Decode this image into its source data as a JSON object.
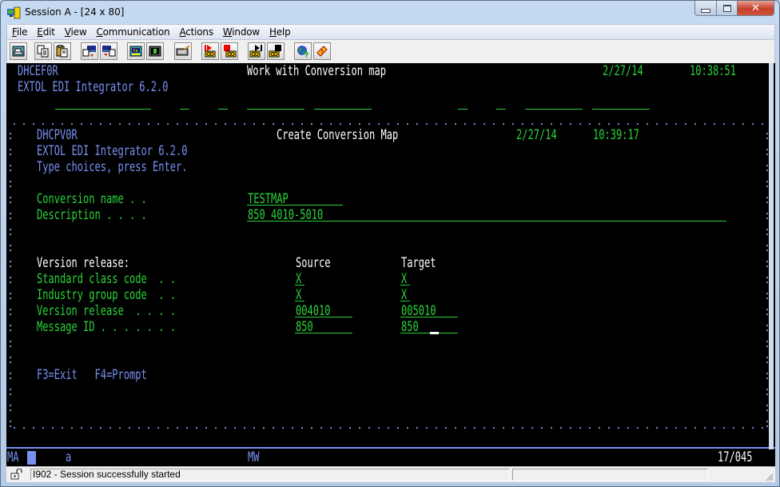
{
  "window": {
    "title": "Session A - [24 x 80]",
    "controls": {
      "minimize": "minimize",
      "maximize": "maximize",
      "close": "close"
    }
  },
  "menubar": {
    "items": [
      {
        "label": "File",
        "mnemonic": "F",
        "rest": "ile"
      },
      {
        "label": "Edit",
        "mnemonic": "E",
        "rest": "dit"
      },
      {
        "label": "View",
        "mnemonic": "V",
        "rest": "iew"
      },
      {
        "label": "Communication",
        "mnemonic": "C",
        "rest": "ommunication"
      },
      {
        "label": "Actions",
        "mnemonic": "A",
        "rest": "ctions"
      },
      {
        "label": "Window",
        "mnemonic": "W",
        "rest": "indow"
      },
      {
        "label": "Help",
        "mnemonic": "H",
        "rest": "elp"
      }
    ]
  },
  "toolbar": {
    "buttons": [
      {
        "icon": "print-screen-icon"
      },
      {
        "icon": "copy-icon"
      },
      {
        "icon": "paste-icon"
      },
      {
        "icon": "send-file-icon"
      },
      {
        "icon": "receive-file-icon"
      },
      {
        "icon": "display-setup-icon"
      },
      {
        "icon": "color-map-icon"
      },
      {
        "icon": "keyboard-map-icon"
      },
      {
        "icon": "record-macro-icon"
      },
      {
        "icon": "stop-macro-icon"
      },
      {
        "icon": "play-macro-icon"
      },
      {
        "icon": "stop-playing-icon"
      },
      {
        "icon": "web-icon"
      },
      {
        "icon": "help-icon"
      }
    ]
  },
  "background_screen": {
    "program": "DHCEF0R",
    "title": "Work with Conversion map",
    "date": "2/27/14",
    "time": "10:38:51",
    "product": "EXTOL EDI Integrator 6.2.0"
  },
  "popup": {
    "program": "DHCPV0R",
    "title": "Create Conversion Map",
    "date": "2/27/14",
    "time": "10:39:17",
    "product": "EXTOL EDI Integrator 6.2.0",
    "instructions": "Type choices, press Enter.",
    "fields": {
      "conversion_name_label": "Conversion name . .",
      "conversion_name_value": "TESTMAP",
      "description_label": "Description . . . .",
      "description_value": "850 4010-5010"
    },
    "version_table": {
      "heading": "Version release:",
      "col_source": "Source",
      "col_target": "Target",
      "rows": [
        {
          "label": "Standard class code  . .",
          "source": "X",
          "target": "X"
        },
        {
          "label": "Industry group code  . .",
          "source": "X",
          "target": "X"
        },
        {
          "label": "Version release  . . . .",
          "source": "004010",
          "target": "005010"
        },
        {
          "label": "Message ID . . . . . . .",
          "source": "850",
          "target": "850"
        }
      ]
    },
    "function_keys": "F3=Exit   F4=Prompt"
  },
  "oia": {
    "mode": "MA",
    "indicator": "a",
    "mw": "MW",
    "cursor_position": "17/045"
  },
  "statusbar": {
    "message": "I902 - Session successfully started"
  },
  "colors": {
    "terminal_bg": "#000000",
    "blue_text": "#7890f0",
    "green_text": "#2ad33a",
    "white_text": "#ffffff"
  }
}
